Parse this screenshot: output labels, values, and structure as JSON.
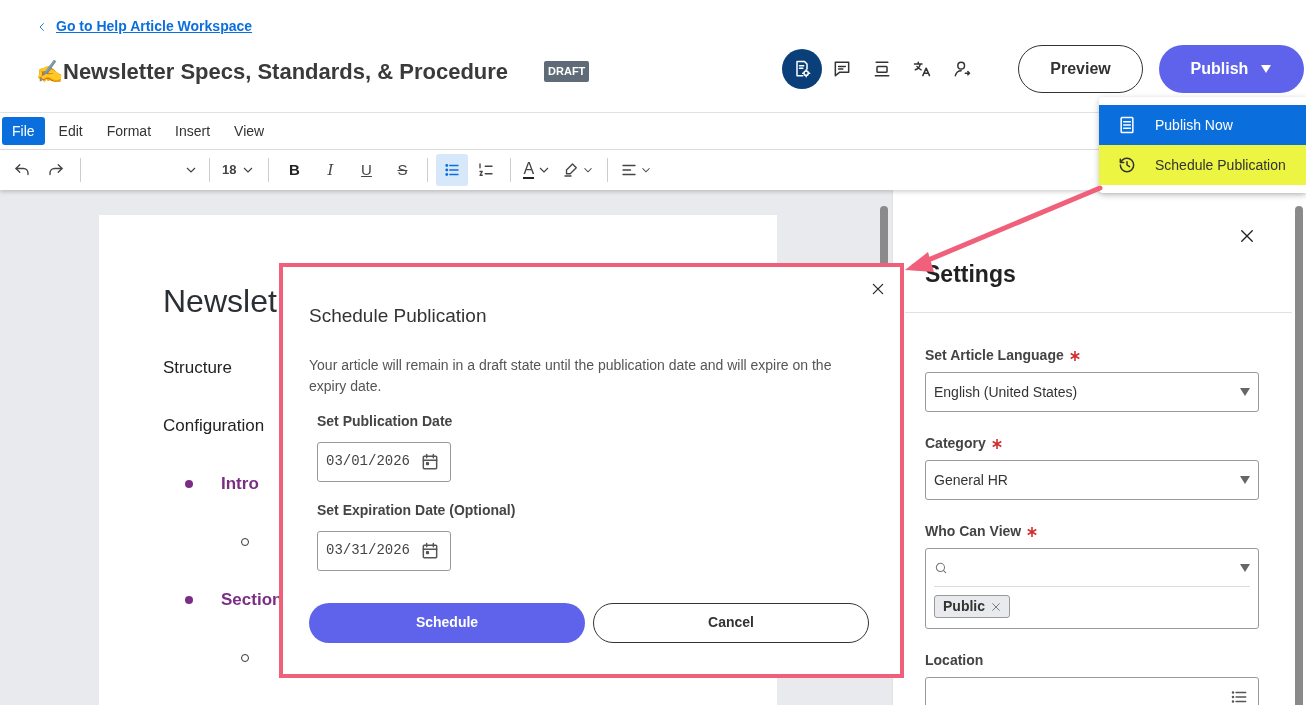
{
  "back_link": "Go to Help Article Workspace",
  "title": {
    "emoji": "✍️",
    "text": "Newsletter Specs, Standards, & Procedure",
    "badge": "DRAFT"
  },
  "header_icons": [
    {
      "kind": "doc-settings",
      "selected": true
    },
    {
      "kind": "comment",
      "selected": false
    },
    {
      "kind": "stack",
      "selected": false
    },
    {
      "kind": "translate",
      "selected": false
    },
    {
      "kind": "person",
      "selected": false
    }
  ],
  "preview_button": "Preview",
  "publish_button": "Publish",
  "publish_menu": [
    {
      "label": "Publish Now",
      "kind": "document",
      "selected": true,
      "highlighted": false
    },
    {
      "label": "Schedule Publication",
      "kind": "history",
      "selected": false,
      "highlighted": true
    }
  ],
  "menu_bar": [
    {
      "label": "File",
      "selected": true
    },
    {
      "label": "Edit",
      "selected": false
    },
    {
      "label": "Format",
      "selected": false
    },
    {
      "label": "Insert",
      "selected": false
    },
    {
      "label": "View",
      "selected": false
    }
  ],
  "toolbar": [
    {
      "kind": "undo"
    },
    {
      "kind": "redo"
    },
    {
      "kind": "divider"
    },
    {
      "kind": "font-family"
    },
    {
      "kind": "divider"
    },
    {
      "kind": "font-size",
      "text": "18"
    },
    {
      "kind": "divider"
    },
    {
      "kind": "bold",
      "text": "B",
      "selected": false
    },
    {
      "kind": "italic",
      "text": "I",
      "selected": false
    },
    {
      "kind": "underline",
      "text": "U",
      "selected": false
    },
    {
      "kind": "strike",
      "text": "S",
      "selected": false
    },
    {
      "kind": "divider"
    },
    {
      "kind": "bullet-list",
      "selected": true
    },
    {
      "kind": "numbered-list",
      "selected": false
    },
    {
      "kind": "divider"
    },
    {
      "kind": "text-color",
      "text": "A"
    },
    {
      "kind": "highlight"
    },
    {
      "kind": "divider"
    },
    {
      "kind": "align"
    }
  ],
  "document": {
    "heading": "Newslet",
    "paragraphs": [
      "Structure",
      "Configuration"
    ],
    "bullets": [
      {
        "text": "Intro",
        "has_sub_item": true
      },
      {
        "text": "Section",
        "has_sub_item": true
      }
    ]
  },
  "dialog": {
    "title": "Schedule Publication",
    "message": "Your article will remain in a draft state until the publication date and will expire on the expiry date.",
    "fields": [
      {
        "label": "Set Publication Date",
        "value": "03/01/2026"
      },
      {
        "label": "Set Expiration Date (Optional)",
        "value": "03/31/2026"
      }
    ],
    "confirm_button": "Schedule",
    "cancel_button": "Cancel"
  },
  "settings": {
    "title": "Settings",
    "fields": [
      {
        "label": "Set Article Language",
        "required": true,
        "kind": "select",
        "value": "English (United States)"
      },
      {
        "label": "Category",
        "required": true,
        "kind": "select",
        "value": "General HR"
      },
      {
        "label": "Who Can View",
        "required": true,
        "kind": "multiselect",
        "tags": [
          "Public"
        ]
      },
      {
        "label": "Location",
        "required": false,
        "kind": "list"
      }
    ]
  }
}
